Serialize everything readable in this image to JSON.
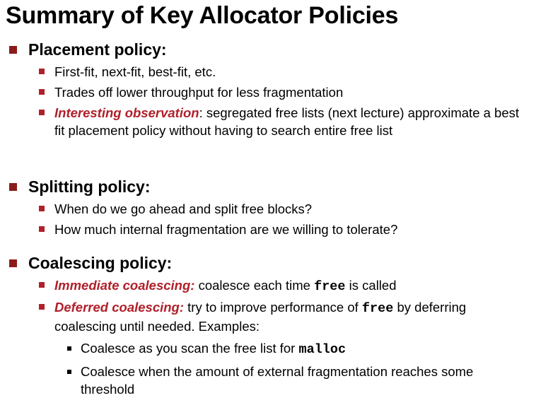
{
  "colors": {
    "accent": "#b0202a",
    "bullet_level1": "#8b1a1a",
    "bullet_level2": "#b0202a",
    "bullet_level3": "#000000",
    "text": "#000000"
  },
  "title": "Summary of Key Allocator Policies",
  "placement": {
    "heading": "Placement policy:",
    "items": [
      "First-fit, next-fit, best-fit, etc.",
      "Trades off lower throughput for less fragmentation"
    ],
    "observation_label": "Interesting observation",
    "observation_text": ": segregated free lists (next lecture) approximate a best fit placement policy without having to search entire free list"
  },
  "splitting": {
    "heading": "Splitting policy:",
    "items": [
      "When do we go ahead and split free blocks?",
      "How much internal fragmentation are we willing to tolerate?"
    ]
  },
  "coalescing": {
    "heading": "Coalescing policy:",
    "immediate_label": "Immediate coalescing:",
    "immediate_text_1": " coalesce each time ",
    "immediate_code": "free",
    "immediate_text_2": " is called",
    "deferred_label": "Deferred coalescing:",
    "deferred_text_1": " try to improve performance of ",
    "deferred_code": "free",
    "deferred_text_2": " by deferring coalescing until needed. Examples:",
    "sub_items": {
      "scan_text": "Coalesce as you scan the free list for ",
      "scan_code": "malloc",
      "threshold_text": "Coalesce when the amount of external fragmentation reaches some threshold"
    }
  }
}
